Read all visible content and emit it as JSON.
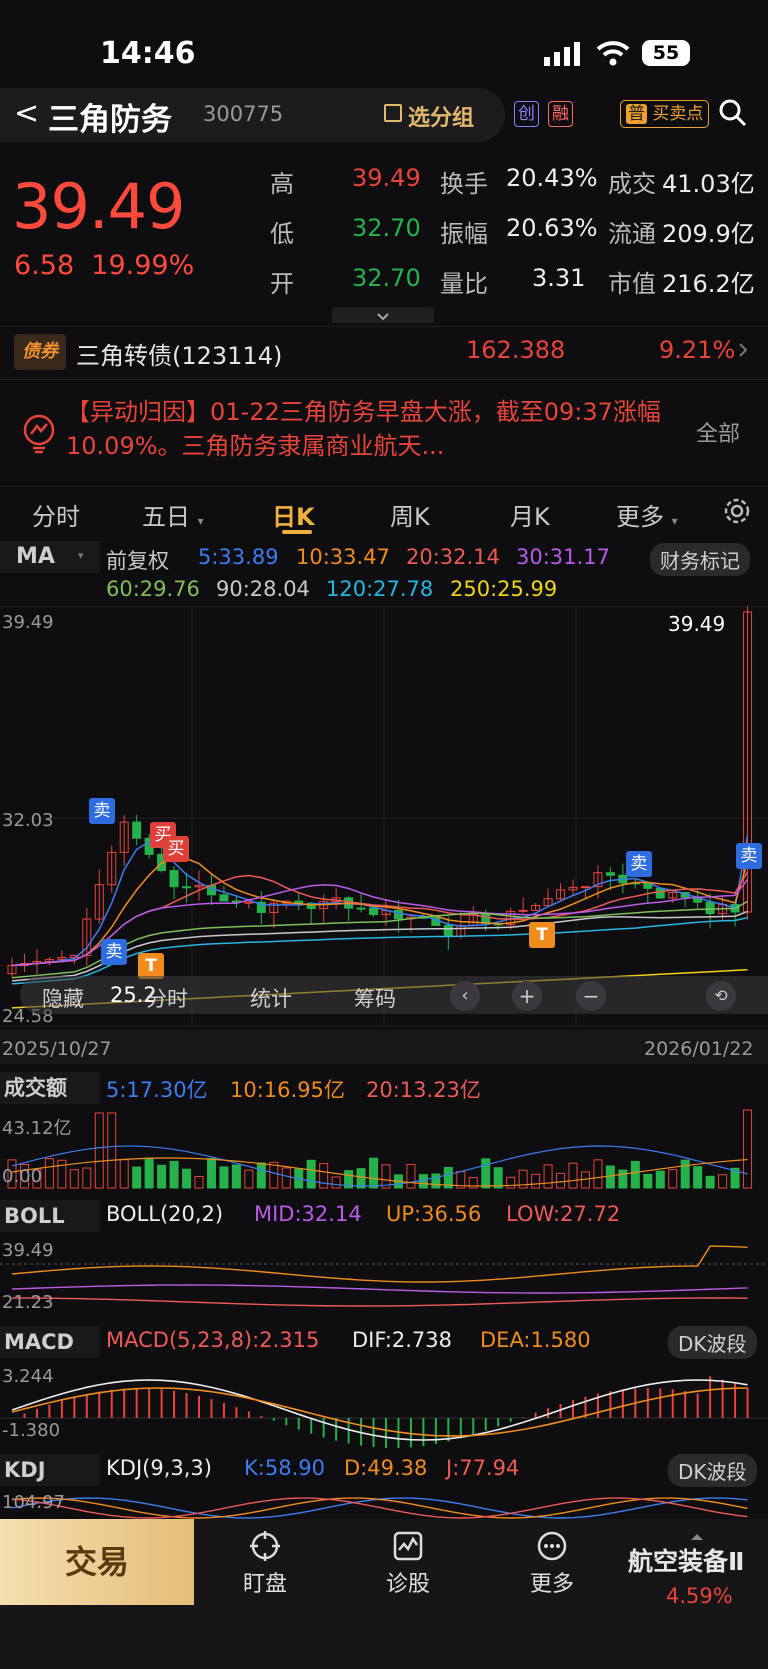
{
  "status": {
    "time": "14:46",
    "battery": "55"
  },
  "header": {
    "back": "<",
    "name": "三角防务",
    "code": "300775",
    "group_btn": "选分组",
    "tag1": "创",
    "tag2": "融",
    "tag3_icon": "普",
    "tag3": "买卖点"
  },
  "quote": {
    "price": "39.49",
    "change": "6.58",
    "change_pct": "19.99%",
    "rows": [
      {
        "l1": "高",
        "v1": "39.49",
        "l2": "换手",
        "v2": "20.43%",
        "l3": "成交",
        "v3": "41.03亿"
      },
      {
        "l1": "低",
        "v1": "32.70",
        "l2": "振幅",
        "v2": "20.63%",
        "l3": "流通",
        "v3": "209.9亿"
      },
      {
        "l1": "开",
        "v1": "32.70",
        "l2": "量比",
        "v2": "3.31",
        "l3": "市值",
        "v3": "216.2亿"
      }
    ],
    "colors": {
      "up": "#e8443a",
      "down": "#25b24a"
    }
  },
  "bond": {
    "tag": "债券",
    "name": "三角转债(123114)",
    "price": "162.388",
    "pct": "9.21%"
  },
  "news": {
    "text": "【异动归因】01-22三角防务早盘大涨，截至09:37涨幅10.09%。三角防务隶属商业航天...",
    "all": "全部"
  },
  "tabs": [
    "分时",
    "五日",
    "日K",
    "周K",
    "月K",
    "更多"
  ],
  "ma": {
    "label": "MA",
    "fq": "前复权",
    "fin": "财务标记",
    "row1": [
      "5:33.89",
      "10:33.47",
      "20:32.14",
      "30:31.17"
    ],
    "row2": [
      "60:29.76",
      "90:28.04",
      "120:27.78",
      "250:25.99"
    ]
  },
  "kchart": {
    "y_top": "39.49",
    "y_mid": "32.03",
    "y_low": "24.58",
    "last": "39.49",
    "date_start": "2025/10/27",
    "date_end": "2026/01/22",
    "markers": {
      "sell": "卖",
      "buy": "买",
      "t": "T"
    },
    "toolbar": [
      "隐藏",
      "分时",
      "统计",
      "筹码"
    ],
    "overlay_num": "25.2"
  },
  "volume": {
    "label": "成交额",
    "v5": "5:17.30亿",
    "v10": "10:16.95亿",
    "v20": "20:13.23亿",
    "top": "43.12亿",
    "bottom": "0.00"
  },
  "boll": {
    "label": "BOLL",
    "p": "BOLL(20,2)",
    "mid": "MID:32.14",
    "up": "UP:36.56",
    "low": "LOW:27.72",
    "top": "39.49",
    "bottom": "21.23"
  },
  "macd": {
    "label": "MACD",
    "p": "MACD(5,23,8):2.315",
    "dif": "DIF:2.738",
    "dea": "DEA:1.580",
    "btn": "DK波段",
    "top": "3.244",
    "bottom": "-1.380"
  },
  "kdj": {
    "label": "KDJ",
    "p": "KDJ(9,3,3)",
    "k": "K:58.90",
    "d": "D:49.38",
    "j": "J:77.94",
    "btn": "DK波段",
    "top": "104.97"
  },
  "nav": {
    "trade": "交易",
    "items": [
      "盯盘",
      "诊股",
      "更多"
    ],
    "sector": "航空装备Ⅱ",
    "sector_pct": "4.59%"
  }
}
